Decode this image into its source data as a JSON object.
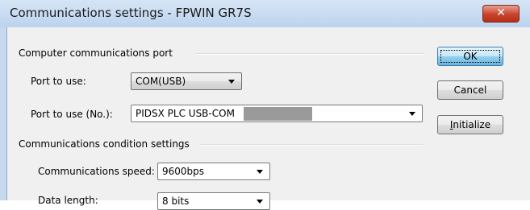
{
  "window": {
    "title": "Communications settings - FPWIN GR7S",
    "close_glyph": "✕"
  },
  "groups": {
    "port": "Computer communications port",
    "conditions": "Communications condition settings"
  },
  "fields": {
    "port_to_use": {
      "label": "Port to use:",
      "value": "COM(USB)"
    },
    "port_no": {
      "label": "Port to use (No.):",
      "value": "PIDSX PLC USB-COM"
    },
    "speed": {
      "label": "Communications speed:",
      "value": "9600bps"
    },
    "data_length": {
      "label": "Data length:",
      "value": "8 bits"
    }
  },
  "buttons": {
    "ok": "OK",
    "cancel": "Cancel",
    "initialize_first": "I",
    "initialize_rest": "nitialize"
  },
  "icons": {
    "close": "close-icon",
    "dropdown": "chevron-down-icon"
  },
  "colors": {
    "title_bg": "#c6d9ef",
    "client_bg": "#f0f0f0",
    "close_red": "#c9422c",
    "default_btn": "#98d1ef",
    "redaction": "#9a9a9a"
  }
}
